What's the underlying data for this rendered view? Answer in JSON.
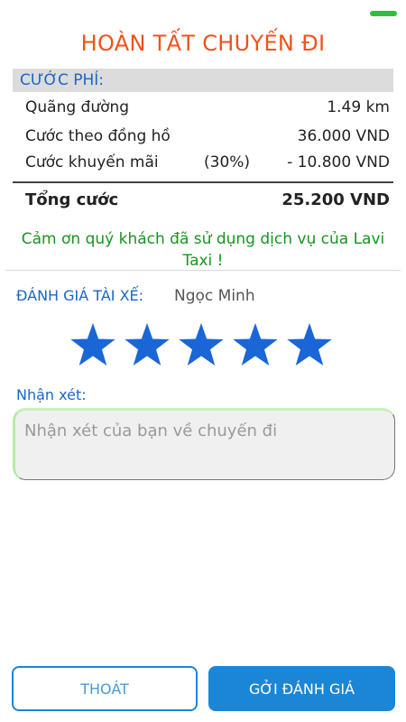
{
  "title": "HOÀN TẤT CHUYẾN ĐI",
  "fee": {
    "header": "CƯỚC PHÍ:",
    "rows": [
      {
        "label": "Quãng đường",
        "percent": "",
        "value": "1.49 km"
      },
      {
        "label": "Cước theo đồng hồ",
        "percent": "",
        "value": "36.000 VND"
      },
      {
        "label": "Cước khuyến mãi",
        "percent": "(30%)",
        "value": "- 10.800 VND"
      }
    ],
    "total_label": "Tổng cước",
    "total_value": "25.200 VND"
  },
  "thanks": "Cảm ơn quý khách đã sử dụng dịch vụ của Lavi Taxi !",
  "rating": {
    "label": "ĐÁNH GIÁ TÀI XẾ:",
    "driver_name": "Ngọc Minh",
    "stars": 5,
    "max_stars": 5,
    "star_color": "#1a66d6"
  },
  "comment": {
    "label": "Nhận xét:",
    "placeholder": "Nhận xét của bạn về chuyến đi",
    "value": ""
  },
  "buttons": {
    "exit": "THOÁT",
    "submit": "GỞI ĐÁNH GIÁ"
  },
  "colors": {
    "title": "#f0521c",
    "accent": "#1a66c8",
    "thanks": "#17951e",
    "primary_button": "#1b86d6"
  }
}
